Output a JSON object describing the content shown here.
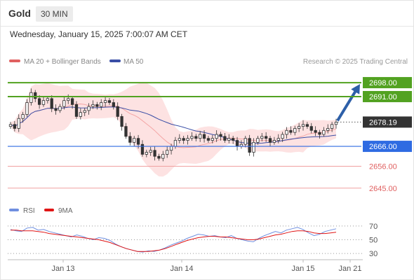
{
  "header": {
    "symbol": "Gold",
    "timeframe": "30 MIN"
  },
  "date_line": "Wednesday, January 15, 2025 7:00:07 AM CET",
  "legend": {
    "ma20_bb": "MA 20 + Bollinger Bands",
    "ma50": "MA 50",
    "credit": "Research © 2025 Trading Central",
    "rsi": "RSI",
    "rsi_ma": "9MA"
  },
  "colors": {
    "green": "#52a221",
    "blue": "#2f6be2",
    "red": "#e06060",
    "dark": "#333333",
    "ma50": "#3a4ea6",
    "bb_fill": "#fde2e2",
    "rsi": "#6f8fe0",
    "rsi_ma": "#e01515"
  },
  "chart_data": [
    {
      "type": "candlestick",
      "title": "Gold",
      "ylim": [
        2640,
        2704
      ],
      "levels": [
        {
          "value": 2698.0,
          "label": "2698.00",
          "color": "#52a221",
          "kind": "resistance"
        },
        {
          "value": 2691.0,
          "label": "2691.00",
          "color": "#52a221",
          "kind": "resistance"
        },
        {
          "value": 2678.19,
          "label": "2678.19",
          "color": "#333333",
          "kind": "last"
        },
        {
          "value": 2666.0,
          "label": "2666.00",
          "color": "#2f6be2",
          "kind": "pivot"
        },
        {
          "value": 2656.0,
          "label": "2656.00",
          "color": "#e06060",
          "kind": "support"
        },
        {
          "value": 2645.0,
          "label": "2645.00",
          "color": "#e06060",
          "kind": "support"
        }
      ],
      "close_series": [
        2677,
        2675,
        2680,
        2682,
        2688,
        2693,
        2690,
        2687,
        2689,
        2690,
        2685,
        2684,
        2686,
        2689,
        2690,
        2687,
        2681,
        2683,
        2684,
        2686,
        2687,
        2686,
        2688,
        2689,
        2688,
        2686,
        2681,
        2676,
        2671,
        2668,
        2670,
        2667,
        2662,
        2663,
        2664,
        2661,
        2660,
        2662,
        2664,
        2666,
        2669,
        2670,
        2669,
        2670,
        2671,
        2670,
        2672,
        2670,
        2669,
        2670,
        2672,
        2671,
        2669,
        2670,
        2669,
        2666,
        2667,
        2670,
        2663,
        2668,
        2670,
        2671,
        2670,
        2668,
        2669,
        2670,
        2672,
        2674,
        2673,
        2675,
        2676,
        2677,
        2676,
        2674,
        2673,
        2672,
        2674,
        2675,
        2677,
        2678.19
      ],
      "projection": {
        "from": 2678.19,
        "to": 2698
      }
    },
    {
      "type": "line",
      "title": "RSI",
      "ylim": [
        25,
        78
      ],
      "reference_lines": [
        70,
        50,
        30
      ],
      "y_ticks": [
        "70",
        "50",
        "30"
      ],
      "x_tick_labels": [
        "Jan 13",
        "Jan 14",
        "Jan 15",
        "Jan 21"
      ],
      "series": [
        {
          "name": "RSI",
          "values": [
            65,
            63,
            62,
            67,
            68,
            64,
            65,
            62,
            60,
            58,
            56,
            54,
            57,
            55,
            52,
            50,
            53,
            52,
            49,
            44,
            40,
            37,
            35,
            33,
            32,
            34,
            33,
            35,
            38,
            42,
            45,
            48,
            52,
            55,
            58,
            57,
            55,
            56,
            54,
            53,
            56,
            52,
            50,
            48,
            47,
            52,
            56,
            59,
            62,
            60,
            64,
            66,
            68,
            65,
            60,
            56,
            58,
            62,
            64,
            66
          ]
        },
        {
          "name": "9MA",
          "values": [
            64,
            64,
            63,
            63,
            63,
            62,
            61,
            59,
            58,
            57,
            56,
            55,
            54,
            53,
            52,
            51,
            50,
            48,
            46,
            43,
            40,
            37,
            35,
            33,
            33,
            33,
            34,
            35,
            37,
            40,
            43,
            46,
            49,
            51,
            53,
            54,
            55,
            55,
            54,
            54,
            53,
            52,
            51,
            50,
            50,
            51,
            53,
            55,
            57,
            58,
            60,
            62,
            63,
            63,
            62,
            60,
            59,
            59,
            60,
            61
          ]
        }
      ]
    }
  ]
}
